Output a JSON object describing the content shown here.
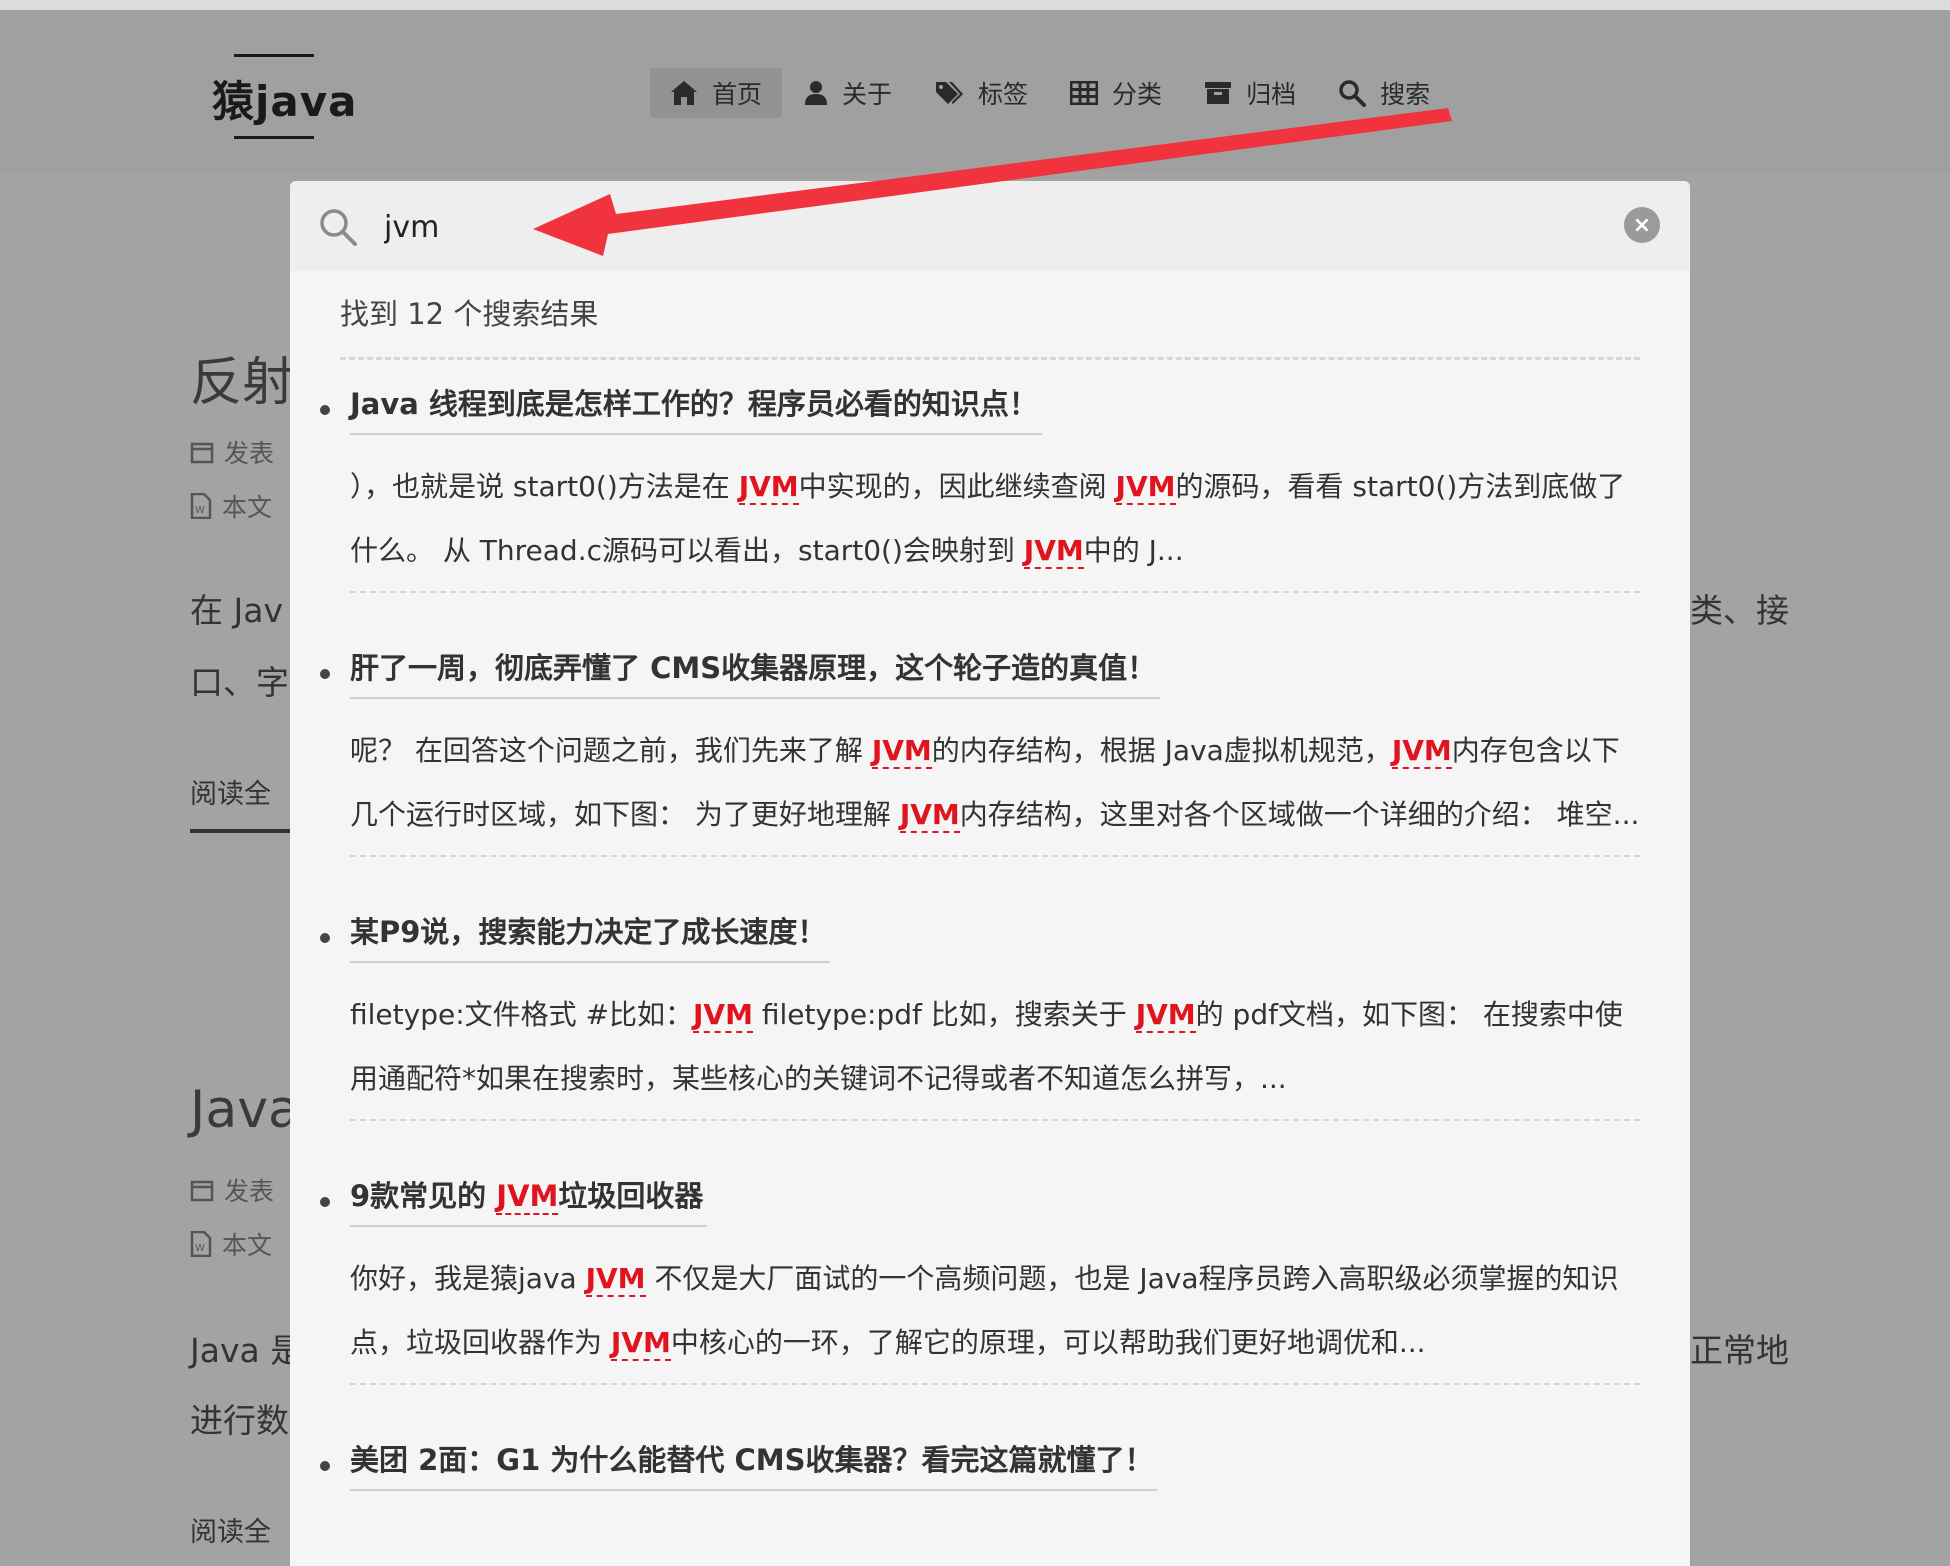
{
  "site": {
    "logo": "猿java",
    "nav": [
      {
        "label": "首页",
        "icon": "home-icon",
        "active": true
      },
      {
        "label": "关于",
        "icon": "user-icon"
      },
      {
        "label": "标签",
        "icon": "tags-icon"
      },
      {
        "label": "分类",
        "icon": "grid-icon"
      },
      {
        "label": "归档",
        "icon": "archive-icon"
      },
      {
        "label": "搜索",
        "icon": "search-icon"
      }
    ]
  },
  "background": {
    "title1": "反射",
    "meta1_a": "发表",
    "meta1_b": "本文",
    "para1_left": "在 Jav",
    "para1_left2": "口、字",
    "para1_right": "类、接",
    "read1": "阅读全",
    "title2": "Java",
    "meta2_a": "发表",
    "meta2_b": "本文",
    "para2_left": "Java 是",
    "para2_left2": "进行数",
    "para2_right": "正常地",
    "read2": "阅读全"
  },
  "search": {
    "query": "jvm",
    "count_text": "找到 12 个搜索结果",
    "clear_label": "×",
    "results": [
      {
        "title": "Java 线程到底是怎样工作的？程序员必看的知识点！",
        "body": [
          {
            "t": "），也就是说 start0()方法是在 "
          },
          {
            "h": "JVM"
          },
          {
            "t": "中实现的，因此继续查阅 "
          },
          {
            "h": "JVM"
          },
          {
            "t": "的源码，看看 start0()方法到底做了什么。 从 Thread.c源码可以看出，start0()会映射到 "
          },
          {
            "h": "JVM"
          },
          {
            "t": "中的 J..."
          }
        ]
      },
      {
        "title": "肝了一周，彻底弄懂了 CMS收集器原理，这个轮子造的真值！",
        "body": [
          {
            "t": "呢？ 在回答这个问题之前，我们先来了解 "
          },
          {
            "h": "JVM"
          },
          {
            "t": "的内存结构，根据 Java虚拟机规范，"
          },
          {
            "h": "JVM"
          },
          {
            "t": "内存包含以下几个运行时区域，如下图： 为了更好地理解 "
          },
          {
            "h": "JVM"
          },
          {
            "t": "内存结构，这里对各个区域做一个详细的介绍： 堆空..."
          }
        ]
      },
      {
        "title": "某P9说，搜索能力决定了成长速度！",
        "body": [
          {
            "t": "filetype:文件格式 #比如："
          },
          {
            "h": "JVM"
          },
          {
            "t": " filetype:pdf 比如，搜索关于 "
          },
          {
            "h": "JVM"
          },
          {
            "t": "的 pdf文档，如下图： 在搜索中使用通配符*如果在搜索时，某些核心的关键词不记得或者不知道怎么拼写，..."
          }
        ]
      },
      {
        "title_parts": [
          {
            "t": "9款常见的 "
          },
          {
            "h": "JVM"
          },
          {
            "t": "垃圾回收器"
          }
        ],
        "body": [
          {
            "t": "你好，我是猿java "
          },
          {
            "h": "JVM"
          },
          {
            "t": " 不仅是大厂面试的一个高频问题，也是 Java程序员跨入高职级必须掌握的知识点，垃圾回收器作为 "
          },
          {
            "h": "JVM"
          },
          {
            "t": "中核心的一环，了解它的原理，可以帮助我们更好地调优和..."
          }
        ]
      },
      {
        "title": "美团 2面：G1 为什么能替代 CMS收集器？看完这篇就懂了！",
        "body": []
      }
    ]
  },
  "colors": {
    "highlight": "#e0141e",
    "overlay": "#a3a3a3",
    "popup": "#f5f5f5",
    "arrow": "#f0333d"
  }
}
